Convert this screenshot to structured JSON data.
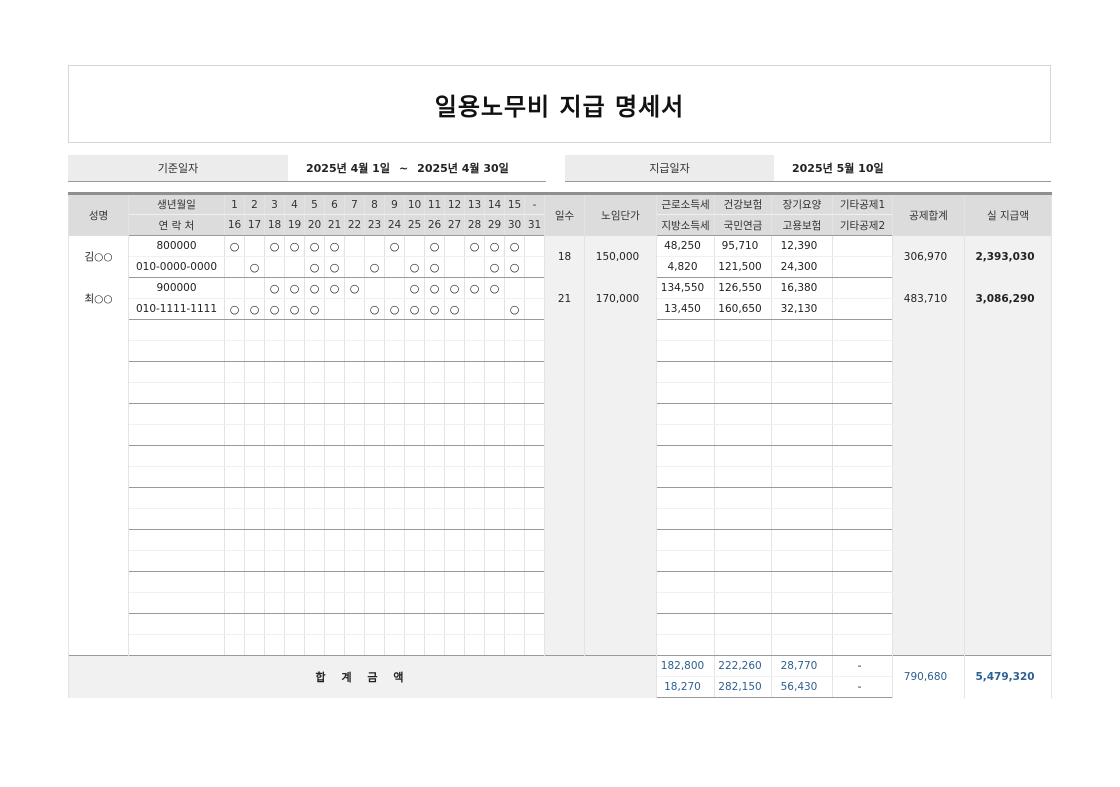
{
  "title": "일용노무비 지급 명세서",
  "info": {
    "base_date_label": "기준일자",
    "base_date_from": "2025년 4월 1일",
    "base_date_sep": "~",
    "base_date_to": "2025년 4월 30일",
    "pay_date_label": "지급일자",
    "pay_date_value": "2025년 5월 10일"
  },
  "header": {
    "name": "성명",
    "birth": "생년월일",
    "contact": "연 락 처",
    "days_top": [
      "1",
      "2",
      "3",
      "4",
      "5",
      "6",
      "7",
      "8",
      "9",
      "10",
      "11",
      "12",
      "13",
      "14",
      "15",
      "-"
    ],
    "days_bottom": [
      "16",
      "17",
      "18",
      "19",
      "20",
      "21",
      "22",
      "23",
      "24",
      "25",
      "26",
      "27",
      "28",
      "29",
      "30",
      "31"
    ],
    "work_days": "일수",
    "unit_price": "노임단가",
    "income_tax": "근로소득세",
    "local_tax": "지방소득세",
    "health": "건강보험",
    "pension": "국민연금",
    "long_term": "장기요양",
    "employment": "고용보험",
    "other1": "기타공제1",
    "other2": "기타공제2",
    "deduction_total": "공제합계",
    "net_pay": "실 지급액"
  },
  "workers": [
    {
      "name": "김○○",
      "birth": "800000",
      "contact": "010-0000-0000",
      "marks_top": [
        "○",
        "",
        "○",
        "○",
        "○",
        "○",
        "",
        "",
        "○",
        "",
        "○",
        "",
        "○",
        "○",
        "○",
        ""
      ],
      "marks_bottom": [
        "",
        "○",
        "",
        "",
        "○",
        "○",
        "",
        "○",
        "",
        "○",
        "○",
        "",
        "",
        "○",
        "○",
        ""
      ],
      "work_days": "18",
      "unit_price": "150,000",
      "income_tax": "48,250",
      "local_tax": "4,820",
      "health": "95,710",
      "pension": "121,500",
      "long_term": "12,390",
      "employment": "24,300",
      "other1": "",
      "other2": "",
      "deduction_total": "306,970",
      "net_pay": "2,393,030"
    },
    {
      "name": "최○○",
      "birth": "900000",
      "contact": "010-1111-1111",
      "marks_top": [
        "",
        "",
        "○",
        "○",
        "○",
        "○",
        "○",
        "",
        "",
        "○",
        "○",
        "○",
        "○",
        "○",
        "",
        ""
      ],
      "marks_bottom": [
        "○",
        "○",
        "○",
        "○",
        "○",
        "",
        "",
        "○",
        "○",
        "○",
        "○",
        "○",
        "",
        "",
        "○",
        ""
      ],
      "work_days": "21",
      "unit_price": "170,000",
      "income_tax": "134,550",
      "local_tax": "13,450",
      "health": "126,550",
      "pension": "160,650",
      "long_term": "16,380",
      "employment": "32,130",
      "other1": "",
      "other2": "",
      "deduction_total": "483,710",
      "net_pay": "3,086,290"
    }
  ],
  "empty_rows": 8,
  "totals": {
    "label": "합 계 금 액",
    "income_tax": "182,800",
    "local_tax": "18,270",
    "health": "222,260",
    "pension": "282,150",
    "long_term": "28,770",
    "employment": "56,430",
    "other1": "-",
    "other2": "-",
    "deduction_total": "790,680",
    "net_pay": "5,479,320"
  },
  "colors": {
    "accent_blue": "#2e5f92",
    "header_gray": "#dcdcdc",
    "light_gray": "#f1f1f1"
  }
}
